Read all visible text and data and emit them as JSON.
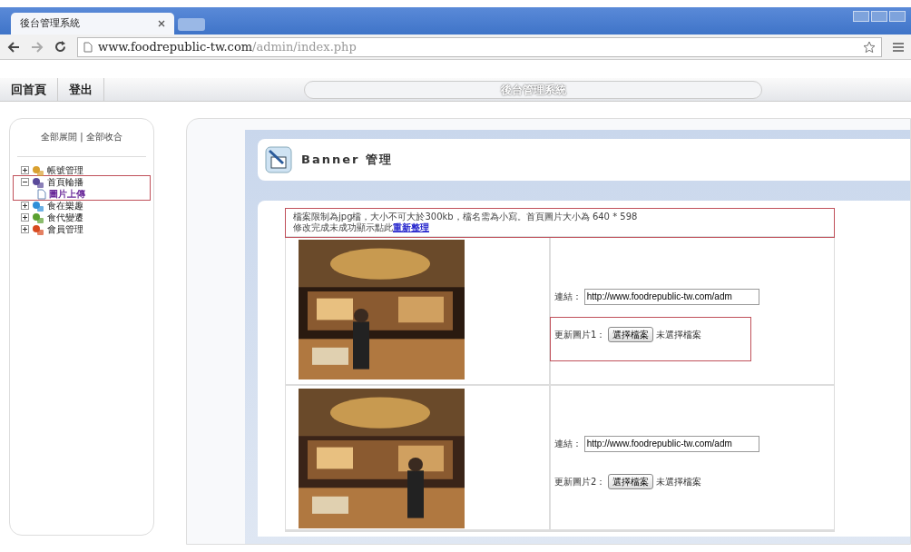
{
  "browser": {
    "tab_title": "後台管理系統",
    "url_host": "www.foodrepublic-tw.com",
    "url_path": "/admin/index.php"
  },
  "top_nav": {
    "links": [
      "回首頁",
      "登出"
    ],
    "banner_title": "後台管理系統"
  },
  "sidebar": {
    "toggle_text": "全部展開 | 全部收合",
    "tree": [
      {
        "label": "帳號管理",
        "expanded": false,
        "selected": false,
        "highlighted": false,
        "color": "#d9a030"
      },
      {
        "label": "首頁輪播",
        "expanded": true,
        "selected": false,
        "highlighted": true,
        "color": "#5a4a9a",
        "children": [
          {
            "label": "圖片上傳",
            "selected": true
          }
        ]
      },
      {
        "label": "食在樂趣",
        "expanded": false,
        "selected": false,
        "highlighted": false,
        "color": "#2f8fd8"
      },
      {
        "label": "食代變遷",
        "expanded": false,
        "selected": false,
        "highlighted": false,
        "color": "#5aa030"
      },
      {
        "label": "會員管理",
        "expanded": false,
        "selected": false,
        "highlighted": false,
        "color": "#d84a20"
      }
    ]
  },
  "page": {
    "title": "Banner 管理",
    "notice": {
      "line_1": "檔案限制為jpg檔，大小不可大於300kb，檔名需為小寫。首頁圖片大小為 640 * 598",
      "line_2": "修改完成未成功顯示點此",
      "link": "重新整理",
      "highlighted": true
    },
    "rows": [
      {
        "link_label": "連結：",
        "link_value": "http://www.foodrepublic-tw.com/adm",
        "upload_label": "更新圖片1：",
        "button": "選擇檔案",
        "file_status": "未選擇檔案",
        "highlighted": true
      },
      {
        "link_label": "連結：",
        "link_value": "http://www.foodrepublic-tw.com/adm",
        "upload_label": "更新圖片2：",
        "button": "選擇檔案",
        "file_status": "未選擇檔案",
        "highlighted": false
      }
    ]
  }
}
